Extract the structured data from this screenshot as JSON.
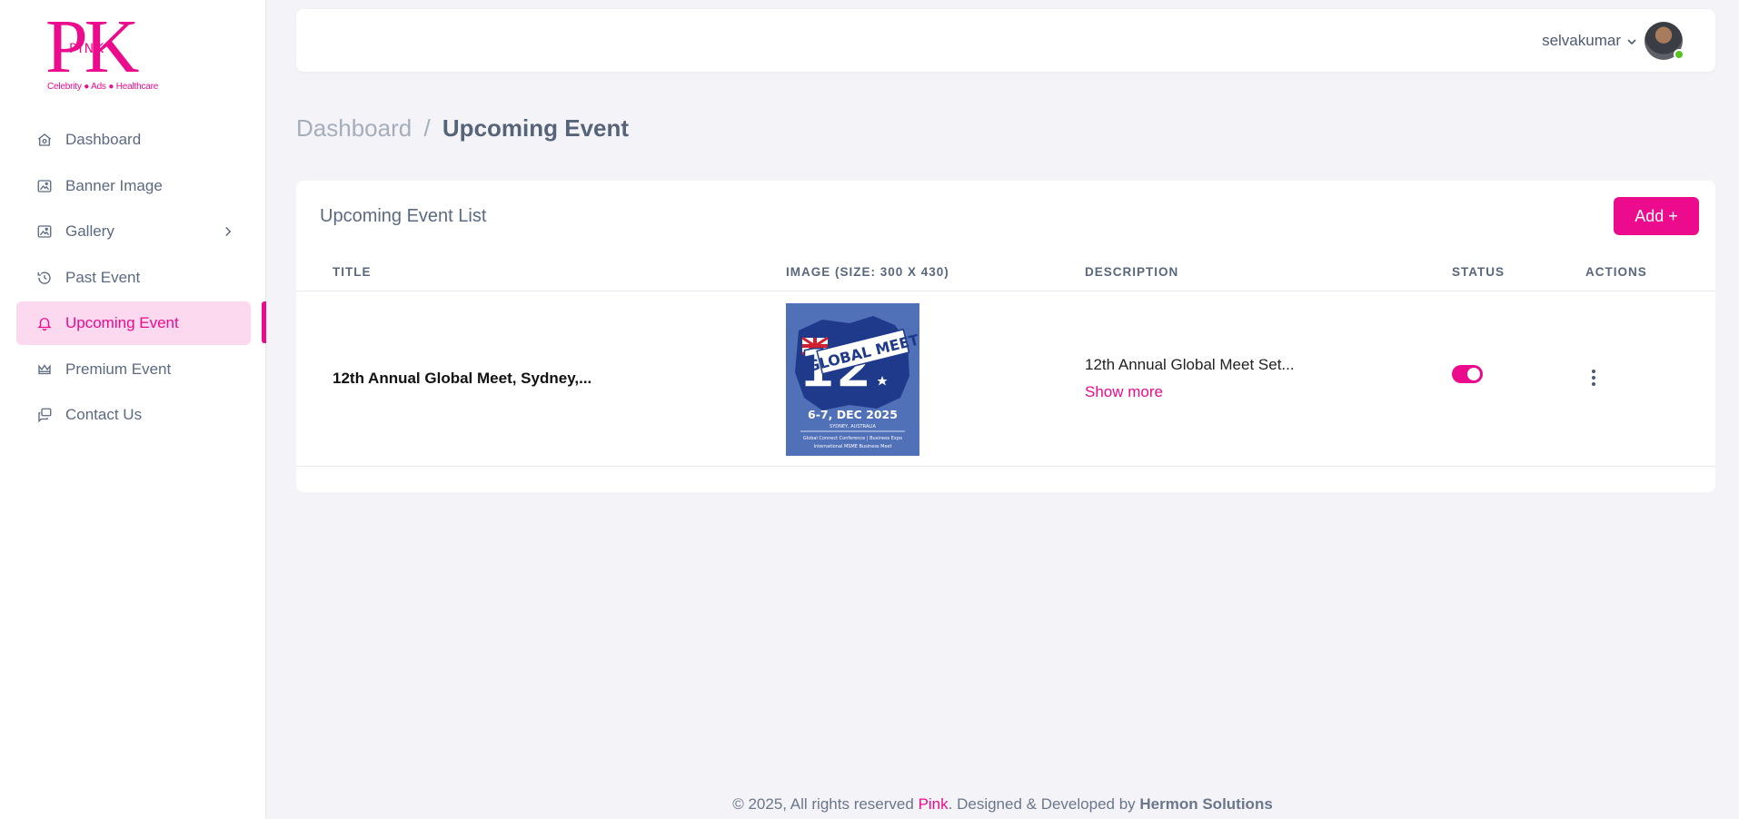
{
  "logo": {
    "letters": "PK",
    "word": "PINK",
    "tagline": "Celebrity ● Ads ● Healthcare"
  },
  "sidebar": {
    "items": [
      {
        "label": "Dashboard",
        "icon": "home-icon"
      },
      {
        "label": "Banner Image",
        "icon": "image-icon"
      },
      {
        "label": "Gallery",
        "icon": "image-icon"
      },
      {
        "label": "Past Event",
        "icon": "history-icon"
      },
      {
        "label": "Upcoming Event",
        "icon": "bell-icon",
        "active": true
      },
      {
        "label": "Premium Event",
        "icon": "crown-icon"
      },
      {
        "label": "Contact Us",
        "icon": "chat-icon"
      }
    ]
  },
  "header": {
    "username": "selvakumar"
  },
  "breadcrumb": {
    "root": "Dashboard",
    "separator": "/",
    "current": "Upcoming Event"
  },
  "card": {
    "title": "Upcoming Event List",
    "add_label": "Add +",
    "columns": [
      "TITLE",
      "IMAGE (SIZE: 300 X 430)",
      "DESCRIPTION",
      "STATUS",
      "ACTIONS"
    ],
    "rows": [
      {
        "title": "12th Annual Global Meet, Sydney,...",
        "image": {
          "big": "12",
          "banner": "GLOBAL MEET",
          "dates": "6-7, DEC 2025",
          "place": "SYDNEY, AUSTRALIA",
          "line1": "Global Connect Conference | Business Expo",
          "line2": "International MSME Business Meet"
        },
        "description": "12th Annual Global Meet Set...",
        "show_more": "Show more",
        "status_on": true
      }
    ]
  },
  "footer": {
    "prefix": "© 2025, All rights reserved ",
    "brand": "Pink",
    "middle": ". Designed & Developed by ",
    "company": "Hermon Solutions"
  },
  "colors": {
    "accent": "#ec0b8c",
    "active_bg": "#fcd9ee",
    "page_bg": "#f4f3f8",
    "online": "#58c322"
  }
}
